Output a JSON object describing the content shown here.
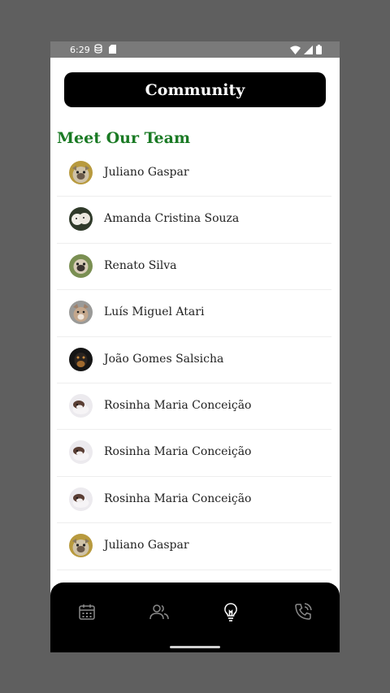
{
  "status_bar": {
    "time": "6:29",
    "left_icons": [
      "sync-icon",
      "sd-card-icon"
    ],
    "right_icons": [
      "wifi-icon",
      "signal-icon",
      "battery-icon"
    ]
  },
  "header": {
    "title": "Community"
  },
  "section": {
    "title": "Meet Our Team",
    "title_color": "#1a7a24"
  },
  "team": [
    {
      "name": "Juliano Gaspar",
      "avatar": "dog-avatar-bulldog"
    },
    {
      "name": "Amanda Cristina Souza",
      "avatar": "dog-avatar-white-fluffy"
    },
    {
      "name": "Renato Silva",
      "avatar": "dog-avatar-pug"
    },
    {
      "name": "Luís Miguel Atari",
      "avatar": "dog-avatar-husky"
    },
    {
      "name": "João Gomes Salsicha",
      "avatar": "dog-avatar-dachshund"
    },
    {
      "name": "Rosinha Maria Conceição",
      "avatar": "dog-avatar-puppy"
    },
    {
      "name": "Rosinha Maria Conceição",
      "avatar": "dog-avatar-puppy"
    },
    {
      "name": "Rosinha Maria Conceição",
      "avatar": "dog-avatar-puppy"
    },
    {
      "name": "Juliano Gaspar",
      "avatar": "dog-avatar-bulldog"
    }
  ],
  "bottom_nav": {
    "items": [
      {
        "icon": "calendar-icon",
        "active": false
      },
      {
        "icon": "people-icon",
        "active": false
      },
      {
        "icon": "lightbulb-icon",
        "active": true
      },
      {
        "icon": "phone-call-icon",
        "active": false
      }
    ],
    "active_color": "#ffffff",
    "inactive_color": "#8a8a8a"
  }
}
